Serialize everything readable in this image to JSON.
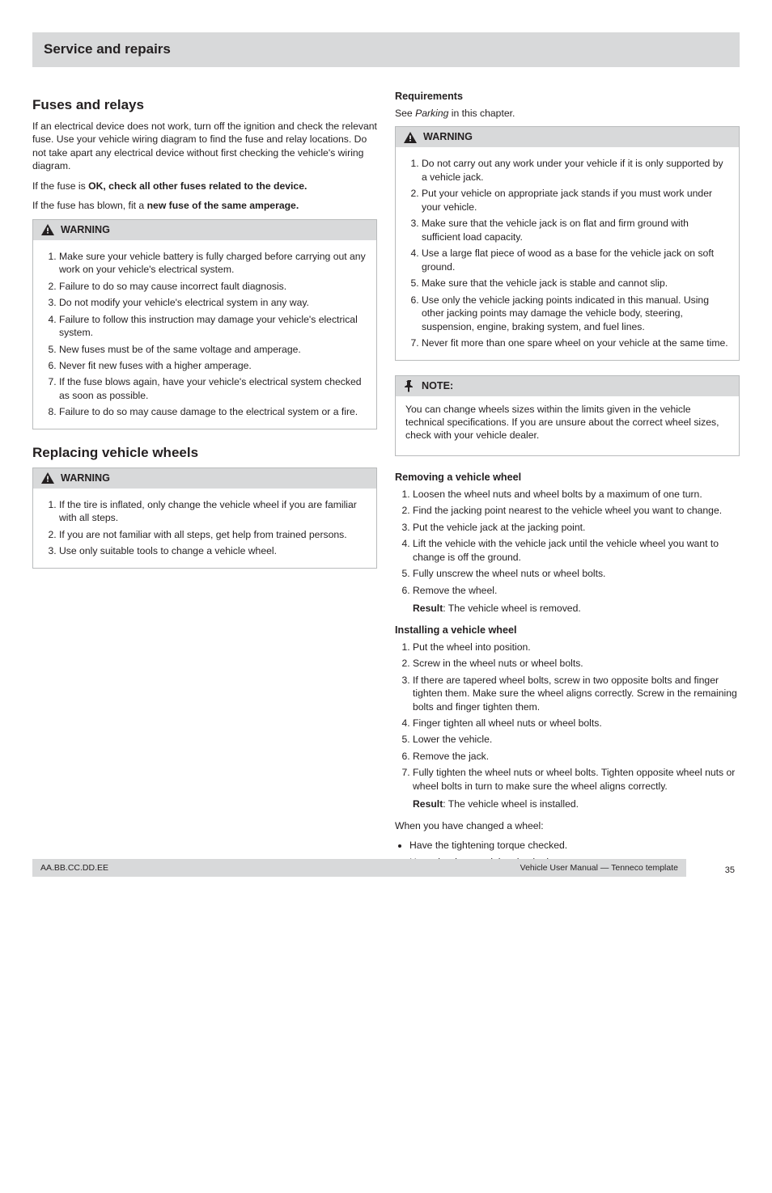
{
  "title": "Service and repairs",
  "left": {
    "h_main": "Fuses and relays",
    "p1": "If an electrical device does not work, turn off the ignition and check the relevant fuse. Use your vehicle wiring diagram to find the fuse and relay locations. Do not take apart any electrical device without first checking the vehicle's wiring diagram.",
    "p2_a": "If the fuse is ",
    "p2_b": "OK, check all other fuses related to the device.",
    "p3_a": "If the fuse has blown, fit a ",
    "p3_b": "new fuse of the same amperage.",
    "warn1_title": "WARNING",
    "warn1": [
      "Make sure your vehicle battery is fully charged before carrying out any work on your vehicle's electrical system.",
      "Failure to do so may cause incorrect fault diagnosis.",
      "Do not modify your vehicle's electrical system in any way.",
      "Failure to follow this instruction may damage your vehicle's electrical system.",
      "New fuses must be of the same voltage and amperage.",
      "Never fit new fuses with a higher amperage.",
      "If the fuse blows again, have your vehicle's electrical system checked as soon as possible.",
      "Failure to do so may cause damage to the electrical system or a fire."
    ],
    "h_replace": "Replacing vehicle wheels",
    "warn2_title": "WARNING",
    "warn2": [
      "If the tire is inflated, only change the vehicle wheel if you are familiar with all steps.",
      "If you are not familiar with all steps, get help from trained persons.",
      "Use only suitable tools to change a vehicle wheel."
    ]
  },
  "right": {
    "h_req": "Requirements",
    "ref1_a": "See ",
    "ref1_b": "Parking",
    "ref1_c": " in this chapter.",
    "warn3_title": "WARNING",
    "warn3": [
      "Do not carry out any work under your vehicle if it is only supported by a vehicle jack.",
      "Put your vehicle on appropriate jack stands if you must work under your vehicle.",
      "Make sure that the vehicle jack is on flat and firm ground with sufficient load capacity.",
      "Use a large flat piece of wood as a base for the vehicle jack on soft ground.",
      "Make sure that the vehicle jack is stable and cannot slip.",
      "Use only the vehicle jacking points indicated in this manual. Using other jacking points may damage the vehicle body, steering, suspension, engine, braking system, and fuel lines.",
      "Never fit more than one spare wheel on your vehicle at the same time."
    ],
    "note_title": "NOTE:",
    "note_body": "You can change wheels sizes within the limits given in the vehicle technical specifications. If you are unsure about the correct wheel sizes, check with your vehicle dealer.",
    "h_remove": "Removing a vehicle wheel",
    "steps_remove": [
      {
        "t": "Loosen the wheel nuts and wheel bolts by a maximum of one turn."
      },
      {
        "t": "Find the jacking point nearest to the vehicle wheel you want to change."
      },
      {
        "t": "Put the vehicle jack at the jacking point."
      },
      {
        "t": "Lift the vehicle with the vehicle jack until the vehicle wheel you want to change is off the ground."
      },
      {
        "t": "Fully unscrew the wheel nuts or wheel bolts."
      },
      {
        "t": "Remove the wheel.",
        "b": "Result",
        "r": ": The vehicle wheel is removed."
      }
    ],
    "h_install": "Installing a vehicle wheel",
    "steps_install": [
      {
        "t": "Put the wheel into position."
      },
      {
        "t": "Screw in the wheel nuts or wheel bolts."
      },
      {
        "t": "If there are tapered wheel bolts, screw in two opposite bolts and finger tighten them. Make sure the wheel aligns correctly. Screw in the remaining bolts and finger tighten them."
      },
      {
        "t": "Finger tighten all wheel nuts or wheel bolts."
      },
      {
        "t": "Lower the vehicle."
      },
      {
        "t": "Remove the jack."
      },
      {
        "t": "Fully tighten the wheel nuts or wheel bolts. Tighten opposite wheel nuts or wheel bolts in turn to make sure the wheel aligns correctly.",
        "b": "Result",
        "r": ": The vehicle wheel is installed."
      }
    ],
    "p_after": "When you have changed a wheel:",
    "after_list": [
      "Have the tightening torque checked.",
      "Have the damaged tire checked."
    ]
  },
  "footer": {
    "left": "AA.BB.CC.DD.EE",
    "right": "Vehicle User Manual — Tenneco template"
  },
  "page_number": "35"
}
